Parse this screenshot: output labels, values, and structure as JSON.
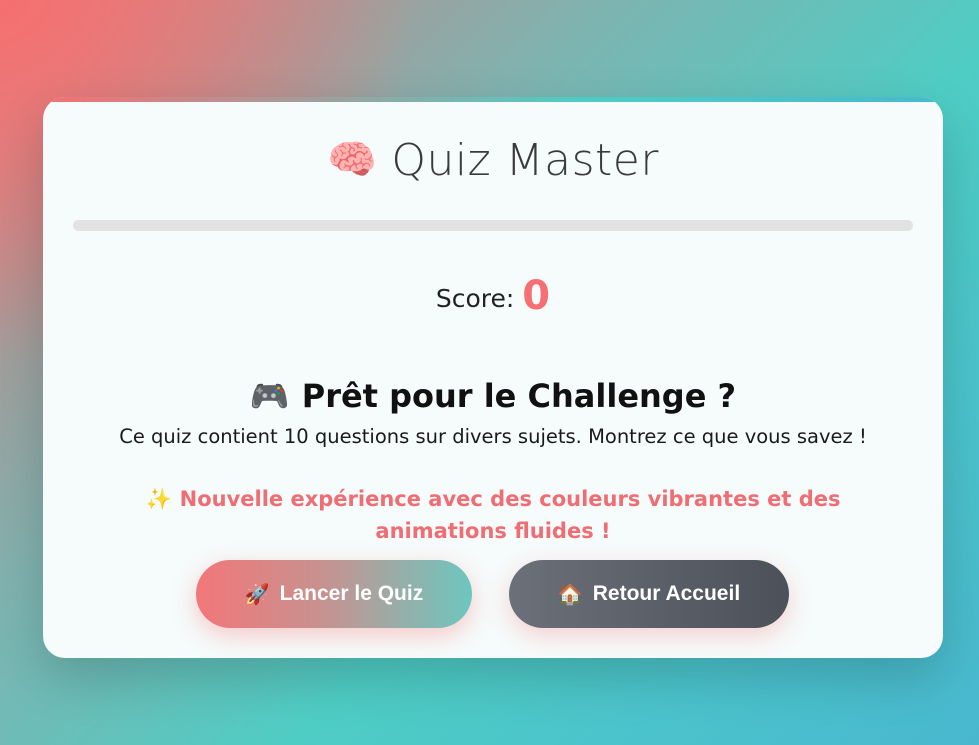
{
  "header": {
    "icon": "brain-icon",
    "icon_glyph": "🧠",
    "title": "Quiz Master"
  },
  "progress": {
    "fraction": 0
  },
  "score": {
    "label": "Score:",
    "value": "0"
  },
  "challenge": {
    "icon": "game-controller-icon",
    "icon_glyph": "🎮",
    "title": "Prêt pour le Challenge ?",
    "description": "Ce quiz contient 10 questions sur divers sujets. Montrez ce que vous savez !"
  },
  "highlight": {
    "icon": "sparkles-icon",
    "icon_glyph": "✨",
    "text": "Nouvelle expérience avec des couleurs vibrantes et des animations fluides !"
  },
  "buttons": {
    "start": {
      "icon": "rocket-icon",
      "icon_glyph": "🚀",
      "label": "Lancer le Quiz"
    },
    "home": {
      "icon": "house-icon",
      "icon_glyph": "🏠",
      "label": "Retour Accueil"
    }
  },
  "colors": {
    "accent": "#f56f73",
    "teal": "#4ecdc4",
    "card": "#f6fbfb"
  }
}
